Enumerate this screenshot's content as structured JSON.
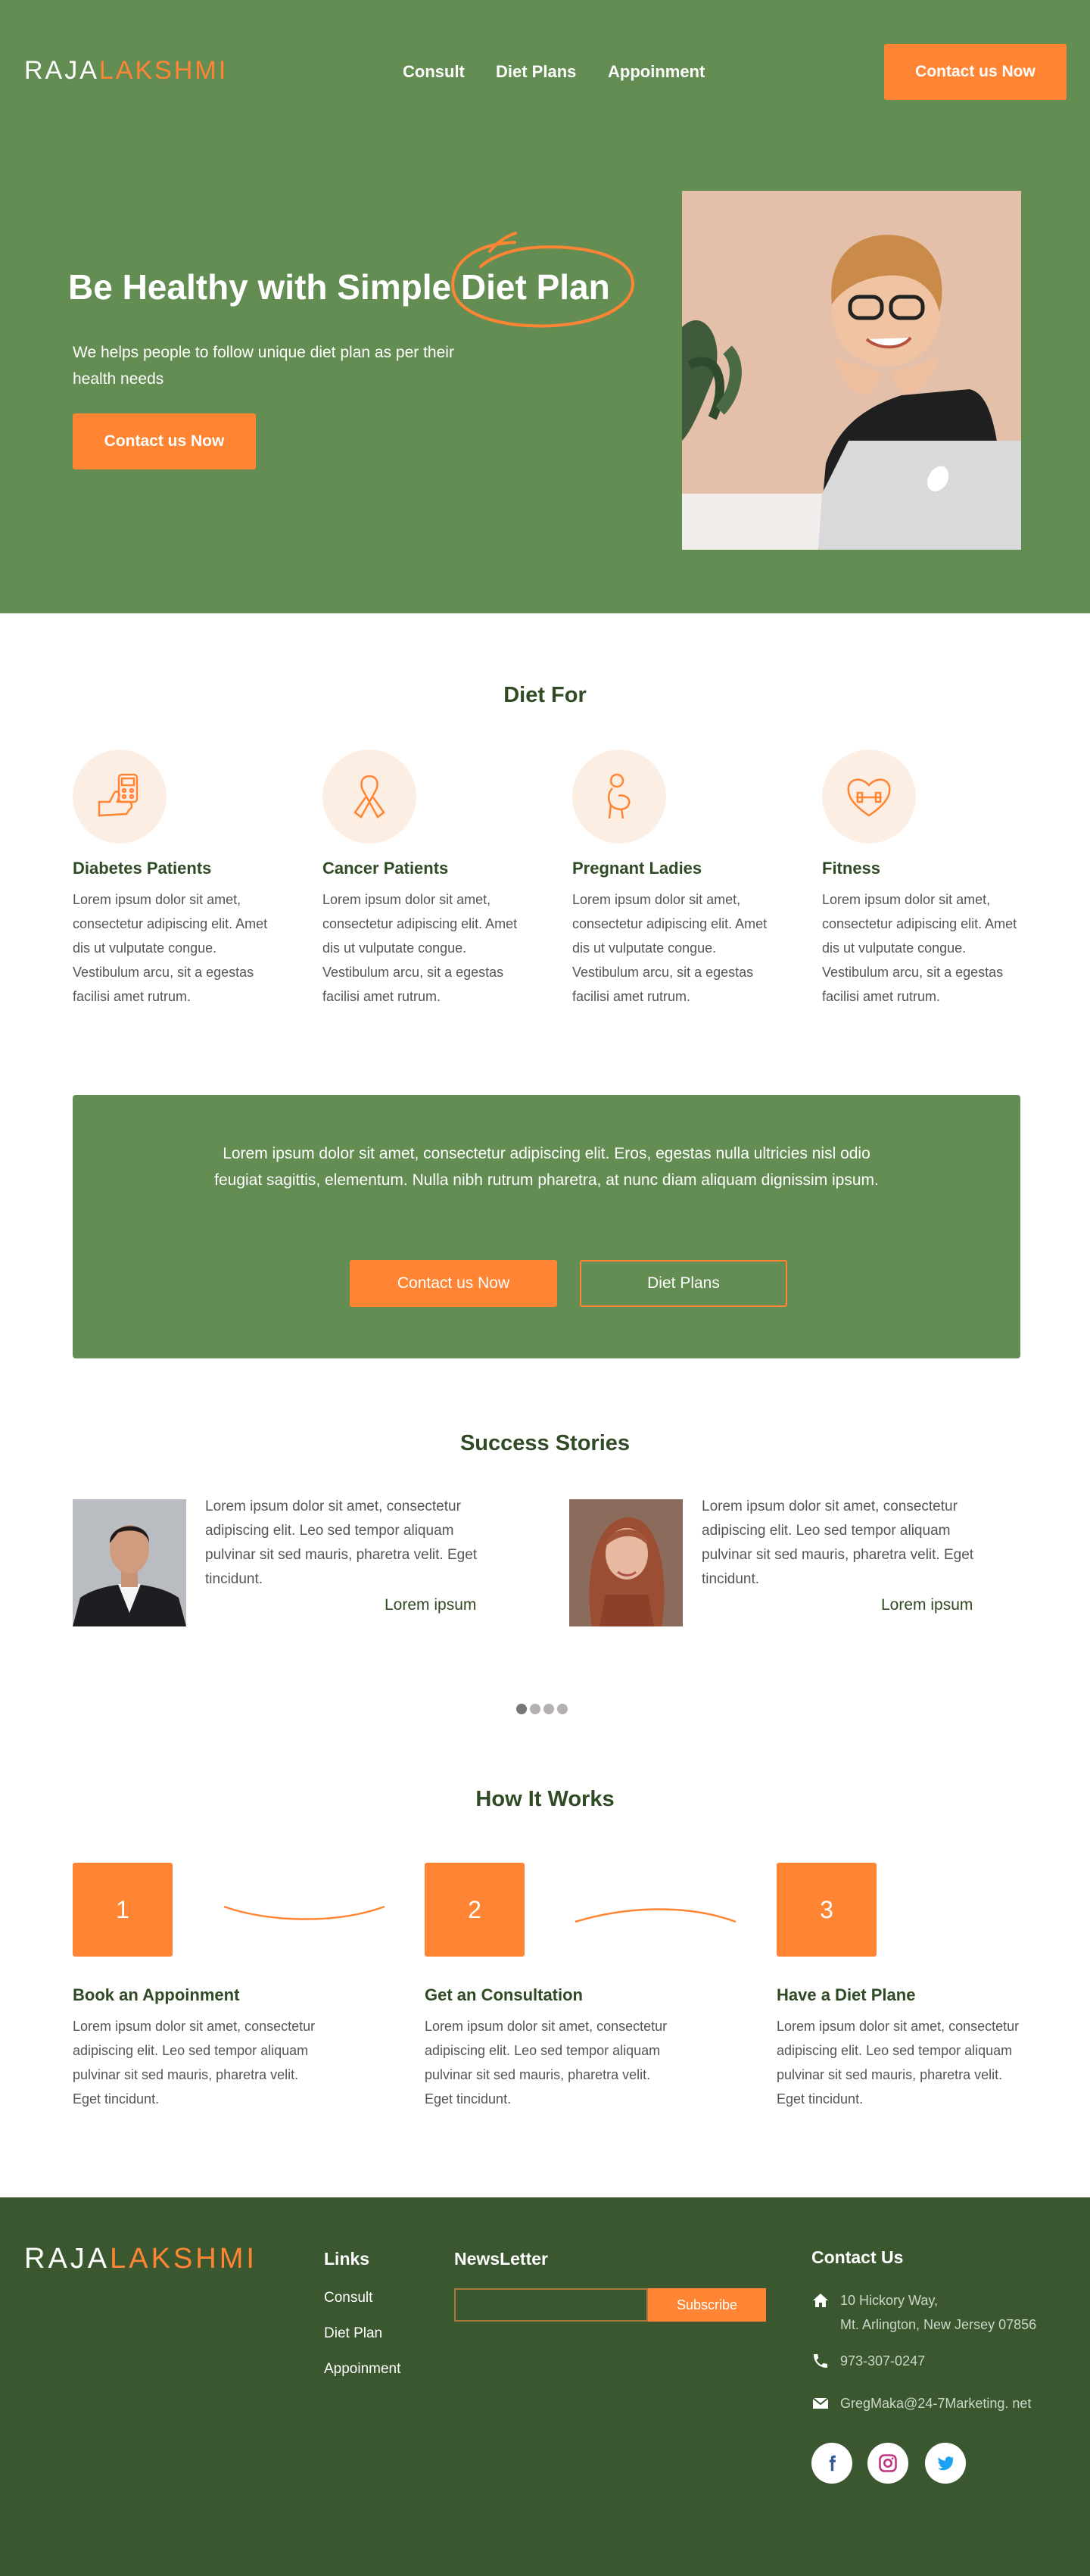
{
  "brand": {
    "part1": "RAJA",
    "part2": "LAKSHMI"
  },
  "nav": {
    "items": [
      "Consult",
      "Diet Plans",
      "Appoinment"
    ],
    "cta": "Contact us Now"
  },
  "hero": {
    "title_plain": "Be Healthy with Simple",
    "title_highlight": "Diet Plan",
    "subtitle": "We helps people to follow unique diet plan as per their health needs",
    "cta": "Contact us Now"
  },
  "diet_for": {
    "title": "Diet For",
    "cards": [
      {
        "icon": "glucose-meter-icon",
        "title": "Diabetes Patients",
        "text": "Lorem ipsum dolor sit amet, consectetur adipiscing elit. Amet dis ut vulputate congue. Vestibulum arcu, sit a egestas facilisi amet rutrum."
      },
      {
        "icon": "cancer-ribbon-icon",
        "title": "Cancer Patients",
        "text": "Lorem ipsum dolor sit amet, consectetur adipiscing elit. Amet dis ut vulputate congue. Vestibulum arcu, sit a egestas facilisi amet rutrum."
      },
      {
        "icon": "pregnant-lady-icon",
        "title": "Pregnant Ladies",
        "text": "Lorem ipsum dolor sit amet, consectetur adipiscing elit. Amet dis ut vulputate congue. Vestibulum arcu, sit a egestas facilisi amet rutrum."
      },
      {
        "icon": "heart-dumbbell-icon",
        "title": "Fitness",
        "text": "Lorem ipsum dolor sit amet, consectetur adipiscing elit. Amet dis ut vulputate congue. Vestibulum arcu, sit a egestas facilisi amet rutrum."
      }
    ]
  },
  "cta_box": {
    "text": "Lorem ipsum dolor sit amet, consectetur adipiscing elit. Eros, egestas nulla ultricies nisl odio feugiat sagittis, elementum. Nulla nibh rutrum pharetra, at nunc diam aliquam dignissim ipsum.",
    "primary": "Contact us Now",
    "secondary": "Diet Plans"
  },
  "stories": {
    "title": "Success Stories",
    "items": [
      {
        "text": "Lorem ipsum dolor sit amet, consectetur adipiscing elit. Leo sed tempor aliquam pulvinar sit sed mauris, pharetra velit. Eget tincidunt.",
        "name": "Lorem ipsum"
      },
      {
        "text": "Lorem ipsum dolor sit amet, consectetur adipiscing elit. Leo sed tempor aliquam pulvinar sit sed mauris, pharetra velit. Eget tincidunt.",
        "name": "Lorem ipsum"
      }
    ],
    "dots": 4,
    "active_dot": 0
  },
  "how": {
    "title": "How It Works",
    "steps": [
      {
        "number": "1",
        "title": "Book an Appoinment",
        "text": "Lorem ipsum dolor sit amet, consectetur adipiscing elit. Leo sed tempor aliquam pulvinar sit sed mauris, pharetra velit. Eget tincidunt."
      },
      {
        "number": "2",
        "title": "Get  an Consultation",
        "text": "Lorem ipsum dolor sit amet, consectetur adipiscing elit. Leo sed tempor aliquam pulvinar sit sed mauris, pharetra velit. Eget tincidunt."
      },
      {
        "number": "3",
        "title": "Have a Diet Plane",
        "text": "Lorem ipsum dolor sit amet, consectetur adipiscing elit. Leo sed tempor aliquam pulvinar sit sed mauris, pharetra velit. Eget tincidunt."
      }
    ]
  },
  "footer": {
    "links_title": "Links",
    "links": [
      "Consult",
      "Diet Plan",
      "Appoinment"
    ],
    "newsletter_title": "NewsLetter",
    "newsletter_placeholder": "",
    "subscribe": "Subscribe",
    "contact_title": "Contact Us",
    "address_line1": "10 Hickory Way,",
    "address_line2": "Mt. Arlington, New Jersey 07856",
    "phone": "973-307-0247",
    "email": "GregMaka@24-7Marketing. net",
    "social": [
      "facebook-icon",
      "instagram-icon",
      "twitter-icon"
    ]
  },
  "colors": {
    "green": "#638d52",
    "dark_green": "#3b5730",
    "orange": "#ff8534",
    "peach": "#fdeee4",
    "heading": "#2f4a24"
  }
}
